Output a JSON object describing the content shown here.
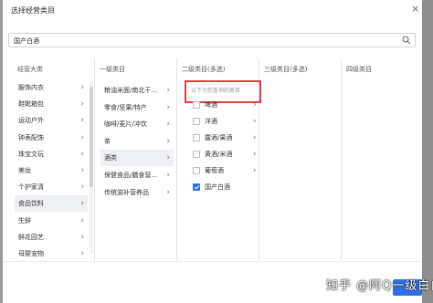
{
  "dialog": {
    "title": "选择经营类目",
    "close_label": "×"
  },
  "search": {
    "value": "国产白酒"
  },
  "columns": {
    "headers": [
      "经营大类",
      "一级类目",
      "二级类目(多选)",
      "三级类目(多选)",
      "四级类目"
    ]
  },
  "level0": {
    "items": [
      "服饰内衣",
      "鞋靴箱包",
      "运动户外",
      "钟表配饰",
      "珠宝文玩",
      "美妆",
      "个护家清",
      "食品饮料",
      "生鲜",
      "鲜花园艺",
      "母婴宠物"
    ],
    "selected": "食品饮料"
  },
  "level1": {
    "items": [
      "粮油米面/南北干...",
      "零食/坚果/特产",
      "咖啡/麦片/冲饮",
      "茶",
      "酒类",
      "保健食品/膳食营...",
      "传统滋补营养品"
    ],
    "selected": "酒类"
  },
  "level2": {
    "hint": "以下为您查询的类目",
    "items": [
      {
        "label": "啤酒",
        "checked": false
      },
      {
        "label": "洋酒",
        "checked": false
      },
      {
        "label": "露酒/果酒",
        "checked": false
      },
      {
        "label": "黄酒/米酒",
        "checked": false
      },
      {
        "label": "葡萄酒",
        "checked": false
      },
      {
        "label": "国产白酒",
        "checked": true
      }
    ]
  },
  "chevron": "›",
  "watermark": "知乎 @阿Q一级白白",
  "colors": {
    "accent": "#2f6fe4",
    "highlight_border": "#e0403a"
  }
}
